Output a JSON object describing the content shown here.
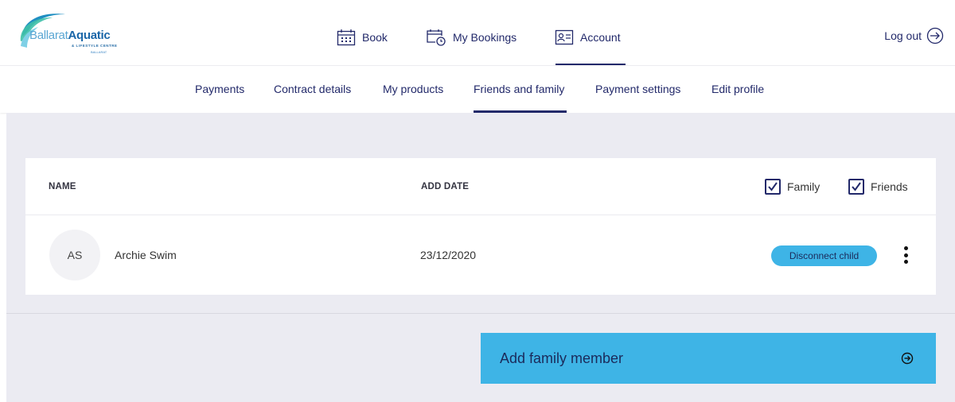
{
  "brand": {
    "name_light": "Ballarat",
    "name_bold": "Aquatic",
    "subline": "& LIFESTYLE CENTRE",
    "city": "BALLARAT"
  },
  "nav": {
    "book": "Book",
    "my_bookings": "My Bookings",
    "account": "Account",
    "logout": "Log out"
  },
  "subnav": {
    "payments": "Payments",
    "contract_details": "Contract details",
    "my_products": "My products",
    "friends_and_family": "Friends and family",
    "payment_settings": "Payment settings",
    "edit_profile": "Edit profile",
    "active": "friends_and_family"
  },
  "table": {
    "col_name": "NAME",
    "col_add_date": "ADD DATE",
    "filters": [
      {
        "label": "Family",
        "checked": true
      },
      {
        "label": "Friends",
        "checked": true
      }
    ],
    "rows": [
      {
        "initials": "AS",
        "name": "Archie Swim",
        "add_date": "23/12/2020",
        "action": "Disconnect child"
      }
    ]
  },
  "add_member": {
    "label": "Add family member",
    "icon": "arrow-right-circle-icon"
  },
  "colors": {
    "navy": "#22296a",
    "accent": "#3eb4e6",
    "background": "#ebebf2"
  }
}
